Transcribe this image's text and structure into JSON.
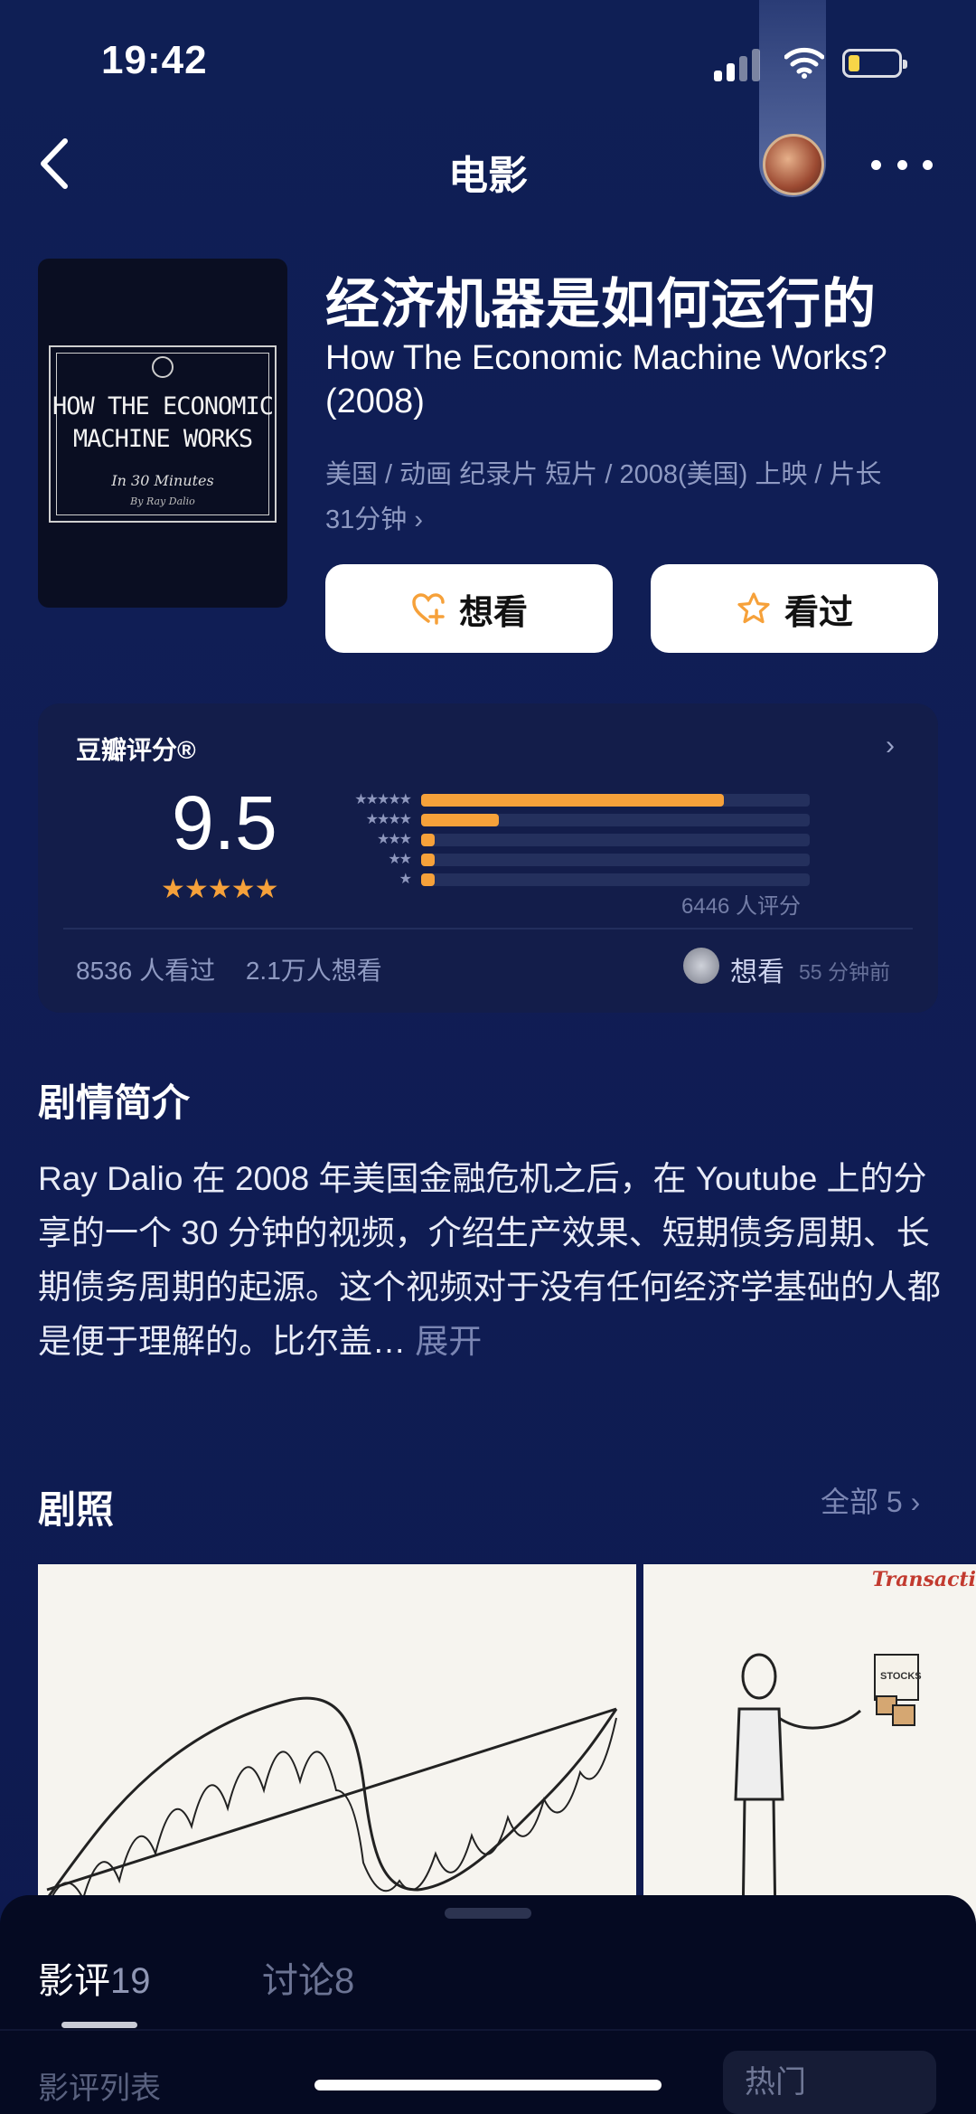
{
  "status": {
    "time": "19:42"
  },
  "nav": {
    "title": "电影"
  },
  "movie": {
    "poster": {
      "title_line1": "HOW THE ECONOMIC",
      "title_line2": "MACHINE WORKS",
      "subtitle": "In 30 Minutes",
      "byline": "By Ray Dalio"
    },
    "title_cn": "经济机器是如何运行的",
    "title_en": "How The Economic Machine Works? (2008)",
    "meta_line1": "美国 / 动画 纪录片 短片 / 2008(美国) 上映 / 片长",
    "meta_line2": "31分钟 ›",
    "want_label": "想看",
    "watched_label": "看过"
  },
  "rating": {
    "label": "豆瓣评分®",
    "score": "9.5",
    "stars": "★★★★★",
    "stars_value": 5,
    "distribution": [
      {
        "stars": "★★★★★",
        "fraction": 0.78
      },
      {
        "stars": "★★★★",
        "fraction": 0.2
      },
      {
        "stars": "★★★",
        "fraction": 0.035
      },
      {
        "stars": "★★",
        "fraction": 0.035
      },
      {
        "stars": "★",
        "fraction": 0.035
      }
    ],
    "count": "6446 人评分",
    "watched": "8536 人看过",
    "wanted": "2.1万人想看",
    "friend_action": "想看",
    "friend_time": "55 分钟前"
  },
  "synopsis": {
    "title": "剧情简介",
    "text": "Ray Dalio 在 2008 年美国金融危机之后，在 Youtube 上的分享的一个 30 分钟的视频，介绍生产效果、短期债务周期、长期债务周期的起源。这个视频对于没有任何经济学基础的人都是便于理解的。比尔盖…",
    "expand": "展开"
  },
  "stills": {
    "title": "剧照",
    "all_label": "全部 5 ›",
    "still2_tag": "Transacti",
    "still2_label": "STOCKS"
  },
  "sheet": {
    "tab1_label": "影评",
    "tab1_count": "19",
    "tab2_label": "讨论",
    "tab2_count": "8",
    "list_label": "影评列表",
    "sort_label": "热门"
  },
  "colors": {
    "accent": "#f6a13a",
    "background": "#101d55",
    "card": "#131d4a"
  }
}
